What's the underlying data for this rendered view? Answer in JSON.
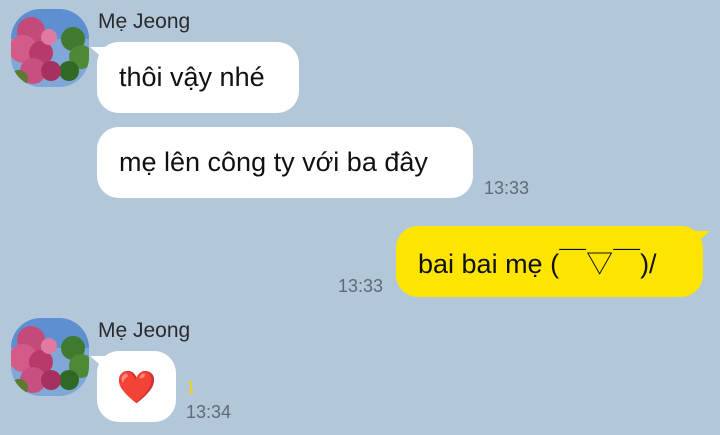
{
  "messages": [
    {
      "sender": "Mẹ Jeong",
      "avatar_icon": "flowers-sky-photo",
      "bubbles": [
        "thôi vậy nhé",
        "mẹ lên công ty với ba đây"
      ],
      "time": "13:33"
    },
    {
      "direction": "outgoing",
      "text": "bai bai mẹ (￣▽￣)/",
      "time": "13:33"
    },
    {
      "sender": "Mẹ Jeong",
      "avatar_icon": "flowers-sky-photo",
      "emoji": "❤️",
      "emoji_name": "red-heart-icon",
      "unread_count": "1",
      "time": "13:34"
    }
  ],
  "colors": {
    "background": "#b2c7da",
    "incoming_bubble": "#ffffff",
    "outgoing_bubble": "#fee500",
    "unread": "#f7d500",
    "time": "#5f6a75"
  }
}
